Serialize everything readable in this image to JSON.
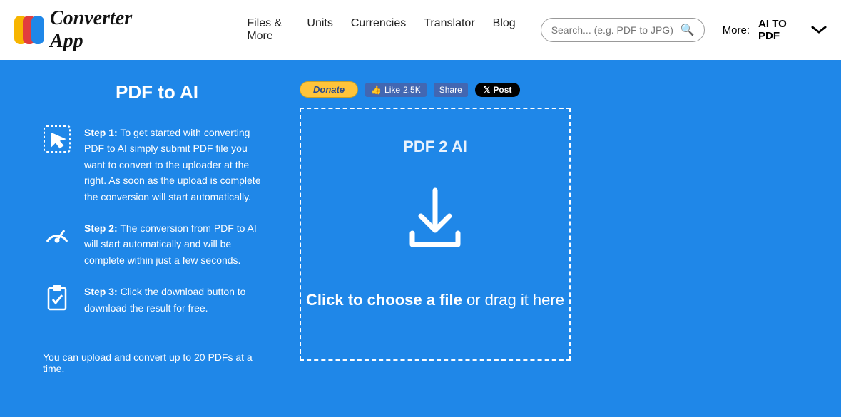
{
  "header": {
    "logo_text": "Converter App",
    "nav": [
      "Files & More",
      "Units",
      "Currencies",
      "Translator",
      "Blog"
    ],
    "search_placeholder": "Search... (e.g. PDF to JPG)",
    "more_label": "More:",
    "more_value": "AI TO PDF"
  },
  "page": {
    "title": "PDF to AI",
    "steps": [
      {
        "label": "Step 1:",
        "text": "To get started with converting PDF to AI simply submit PDF file you want to convert to the uploader at the right. As soon as the upload is complete the conversion will start automatically."
      },
      {
        "label": "Step 2:",
        "text": "The conversion from PDF to AI will start automatically and will be complete within just a few seconds."
      },
      {
        "label": "Step 3:",
        "text": "Click the download button to download the result for free."
      }
    ],
    "footnote": "You can upload and convert up to 20 PDFs at a time."
  },
  "social": {
    "donate": "Donate",
    "like": "Like",
    "like_count": "2.5K",
    "share": "Share",
    "xpost": "Post"
  },
  "dropzone": {
    "title": "PDF 2 AI",
    "cta_bold": "Click to choose a file",
    "cta_rest": "or drag it here"
  }
}
